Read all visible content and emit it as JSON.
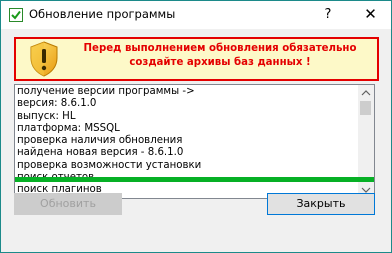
{
  "window": {
    "title": "Обновление программы",
    "help_glyph": "?",
    "close_glyph": "✕"
  },
  "warning": {
    "icon": "shield-warning-icon",
    "line1": "Перед выполнением обновления обязательно",
    "line2": "создайте архивы баз данных !",
    "text_color": "#e40000",
    "background": "#fdf9c8"
  },
  "log": {
    "lines": [
      "получение версии программы ->",
      "версия: 8.6.1.0",
      "выпуск: HL",
      "платформа: MSSQL",
      "проверка наличия обновления",
      "найдена новая версия - 8.6.1.0",
      "проверка возможности установки",
      "поиск отчетов",
      "поиск плагинов"
    ]
  },
  "progress": {
    "percent": 100,
    "color": "#06b025"
  },
  "buttons": {
    "update_label": "Обновить",
    "close_label": "Закрыть"
  }
}
